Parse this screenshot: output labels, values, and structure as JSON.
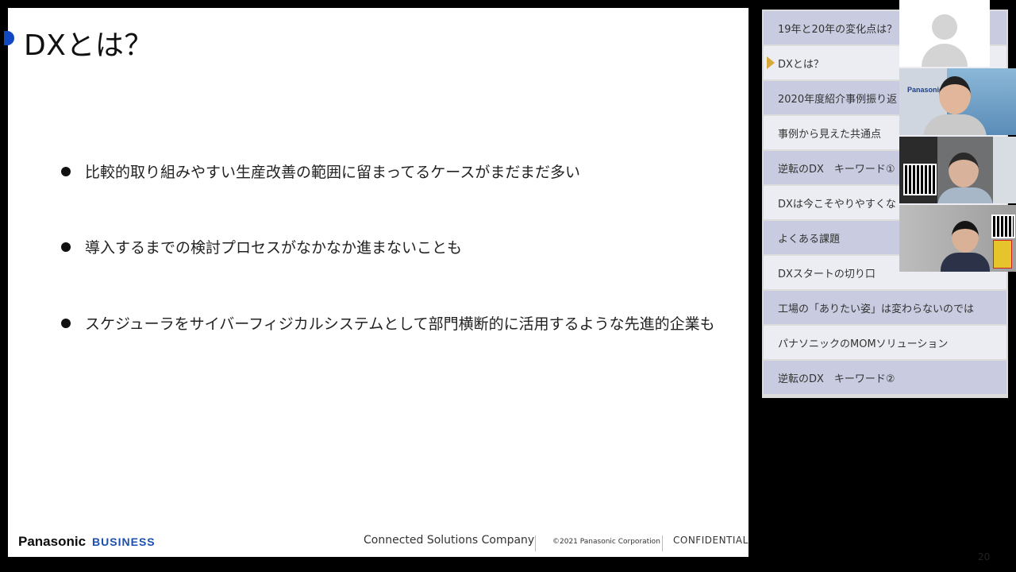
{
  "slide": {
    "title": "DXとは？",
    "bullets": [
      "比較的取り組みやすい生産改善の範囲に留まってるケースがまだまだ多い",
      "導入するまでの検討プロセスがなかなか進まないことも",
      "スケジューラをサイバーフィジカルシステムとして部門横断的に活用するような先進的企業も"
    ],
    "footer": {
      "brand": "Panasonic",
      "brand_sub": "BUSINESS",
      "company": "Connected Solutions Company",
      "copyright": "©2021 Panasonic Corporation",
      "confidential": "CONFIDENTIAL"
    }
  },
  "outline": {
    "items": [
      {
        "label": "19年と20年の変化点は？",
        "current": false
      },
      {
        "label": "DXとは？",
        "current": true
      },
      {
        "label": "2020年度紹介事例振り返",
        "current": false
      },
      {
        "label": "事例から見えた共通点",
        "current": false
      },
      {
        "label": "逆転のDX　キーワード①",
        "current": false
      },
      {
        "label": "DXは今こそやりやすくな",
        "current": false
      },
      {
        "label": "よくある課題",
        "current": false
      },
      {
        "label": "DXスタートの切り口",
        "current": false
      },
      {
        "label": "工場の「ありたい姿」は変わらないのでは",
        "current": false
      },
      {
        "label": "パナソニックのMOMソリューション",
        "current": false
      },
      {
        "label": "逆転のDX　キーワード②",
        "current": false
      }
    ]
  },
  "video_tiles": {
    "tile2_logo": "Panasonic"
  },
  "page_number": "20",
  "colors": {
    "accent_blue": "#1248c4",
    "current_arrow": "#d7a83a",
    "outline_alt": "#c9cce0"
  }
}
